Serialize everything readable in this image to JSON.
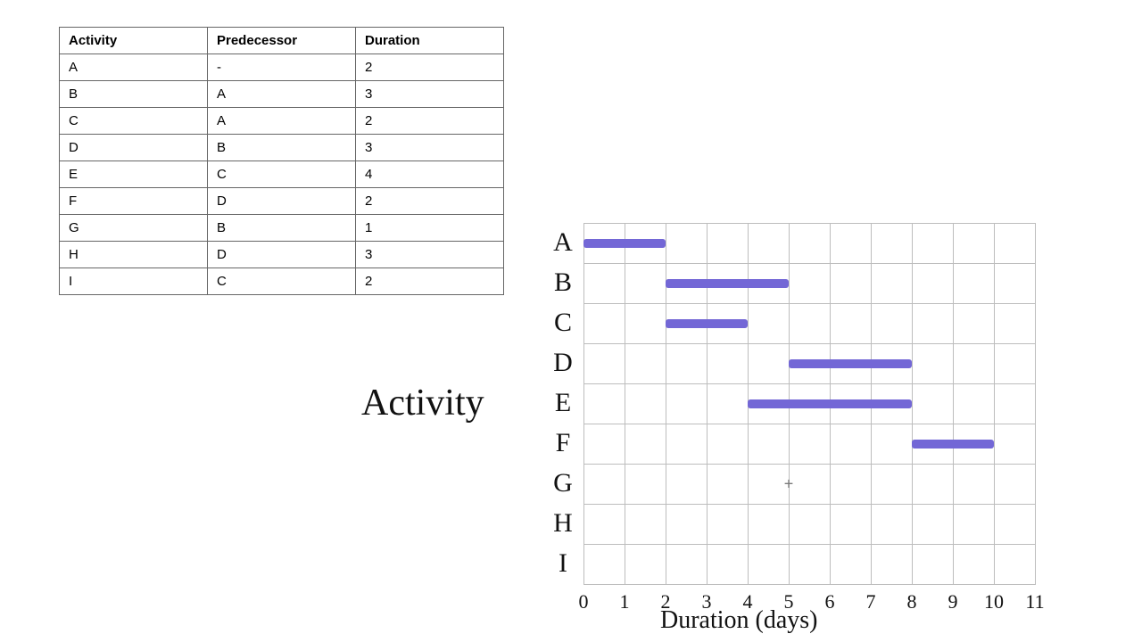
{
  "table": {
    "headers": [
      "Activity",
      "Predecessor",
      "Duration"
    ],
    "rows": [
      {
        "activity": "A",
        "predecessor": "-",
        "duration": "2"
      },
      {
        "activity": "B",
        "predecessor": "A",
        "duration": "3"
      },
      {
        "activity": "C",
        "predecessor": "A",
        "duration": "2"
      },
      {
        "activity": "D",
        "predecessor": "B",
        "duration": "3"
      },
      {
        "activity": "E",
        "predecessor": "C",
        "duration": "4"
      },
      {
        "activity": "F",
        "predecessor": "D",
        "duration": "2"
      },
      {
        "activity": "G",
        "predecessor": "B",
        "duration": "1"
      },
      {
        "activity": "H",
        "predecessor": "D",
        "duration": "3"
      },
      {
        "activity": "I",
        "predecessor": "C",
        "duration": "2"
      }
    ]
  },
  "labels": {
    "y_axis": "Activity",
    "x_axis": "Duration (days)"
  },
  "chart_data": {
    "type": "bar",
    "orientation": "horizontal-gantt",
    "xlabel": "Duration (days)",
    "ylabel": "Activity",
    "xlim": [
      0,
      11
    ],
    "x_ticks": [
      "0",
      "1",
      "2",
      "3",
      "4",
      "5",
      "6",
      "7",
      "8",
      "9",
      "10",
      "11"
    ],
    "categories": [
      "A",
      "B",
      "C",
      "D",
      "E",
      "F",
      "G",
      "H",
      "I"
    ],
    "bars": [
      {
        "activity": "A",
        "start": 0,
        "end": 2
      },
      {
        "activity": "B",
        "start": 2,
        "end": 5
      },
      {
        "activity": "C",
        "start": 2,
        "end": 4
      },
      {
        "activity": "D",
        "start": 5,
        "end": 8
      },
      {
        "activity": "E",
        "start": 4,
        "end": 8
      },
      {
        "activity": "F",
        "start": 8,
        "end": 10
      }
    ],
    "bar_color": "#7367d6",
    "cursor": {
      "activity": "G",
      "x": 5
    }
  }
}
